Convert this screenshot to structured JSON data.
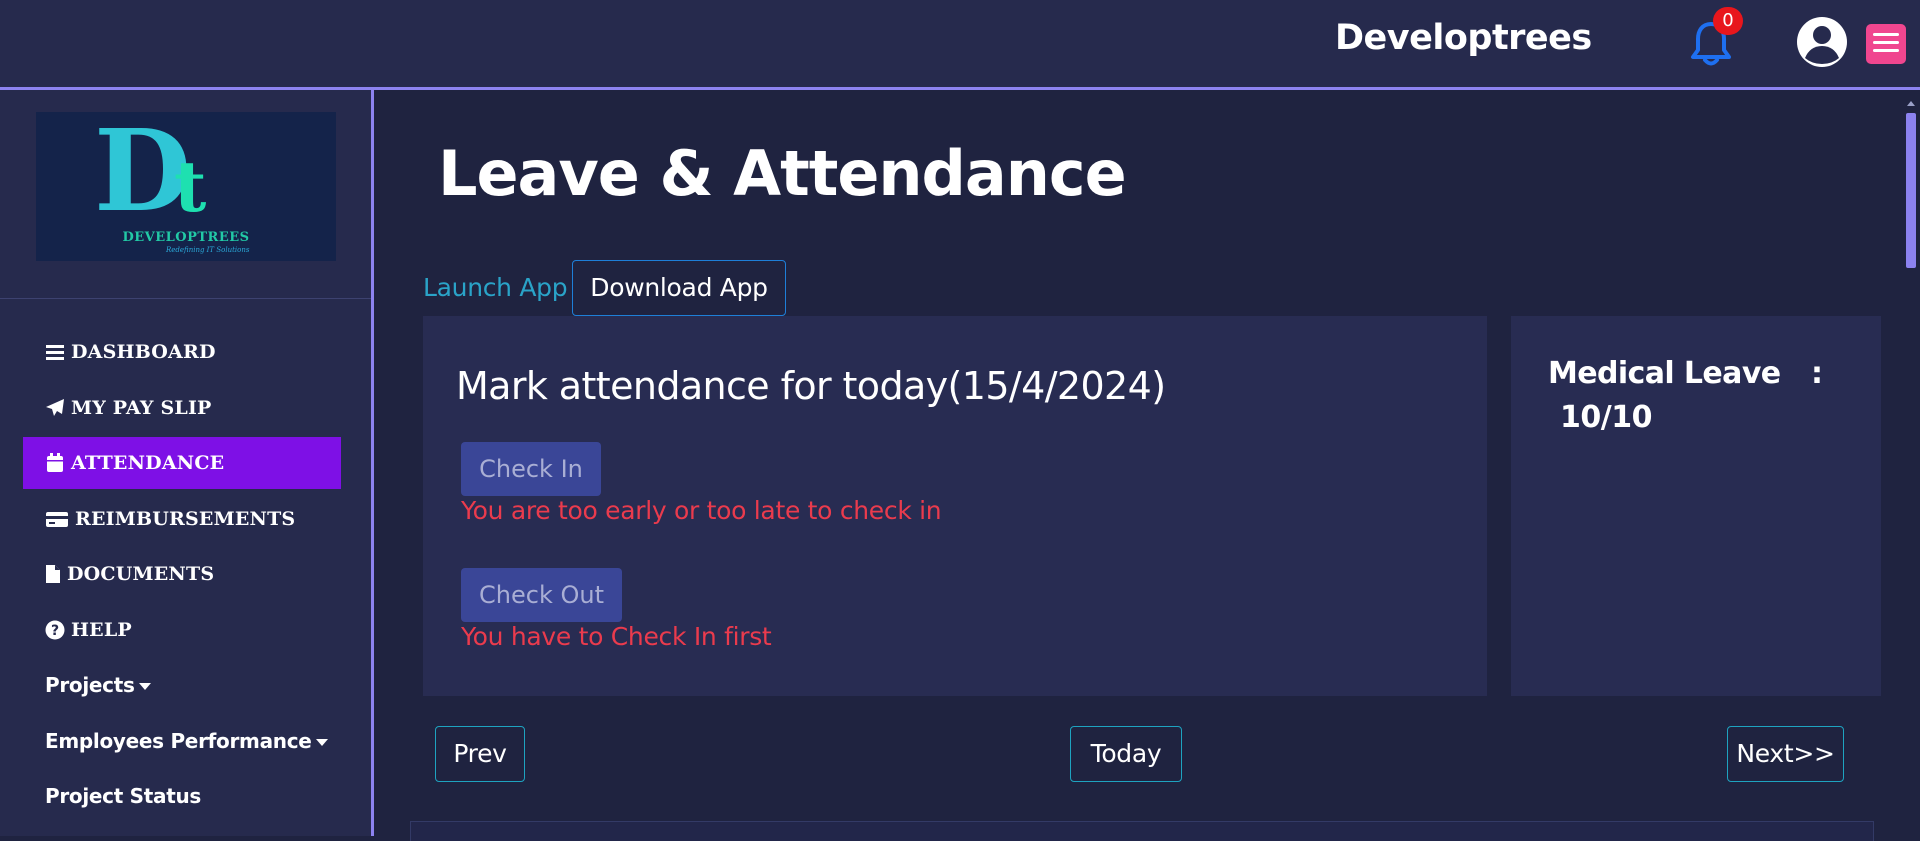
{
  "header": {
    "brand": "Developtrees",
    "notification_count": "0"
  },
  "logo": {
    "wordmark": "DEVELOPTREES",
    "tagline": "Redefining IT Solutions"
  },
  "sidebar": {
    "items": [
      {
        "label": "DASHBOARD",
        "icon": "bars-icon"
      },
      {
        "label": "MY PAY SLIP",
        "icon": "paper-plane-icon"
      },
      {
        "label": "ATTENDANCE",
        "icon": "calendar-icon",
        "active": true
      },
      {
        "label": "REIMBURSEMENTS",
        "icon": "credit-card-icon"
      },
      {
        "label": "DOCUMENTS",
        "icon": "file-icon"
      },
      {
        "label": "HELP",
        "icon": "question-circle-icon"
      },
      {
        "label": "Projects",
        "dropdown": true
      },
      {
        "label": "Employees Performance",
        "dropdown": true
      },
      {
        "label": "Project Status"
      }
    ]
  },
  "main": {
    "title": "Leave & Attendance",
    "launch_app": "Launch App",
    "download_app": "Download App",
    "attendance": {
      "title": "Mark attendance for today(15/4/2024)",
      "check_in": "Check In",
      "check_in_error": "You are too early or too late to check in",
      "check_out": "Check Out",
      "check_out_error": "You have to Check In first"
    },
    "leave": {
      "label": "Medical Leave",
      "colon": ":",
      "value": "10/10"
    },
    "pager": {
      "prev": "Prev",
      "today": "Today",
      "next": "Next>>"
    }
  },
  "colors": {
    "background": "#1f2340",
    "panel": "#282c52",
    "active_nav": "#7e10e6",
    "accent_border": "#8d83f0",
    "error": "#ea3b4d",
    "badge": "#e8161c",
    "menu_button": "#f0468f",
    "bell": "#1e6ff0"
  }
}
